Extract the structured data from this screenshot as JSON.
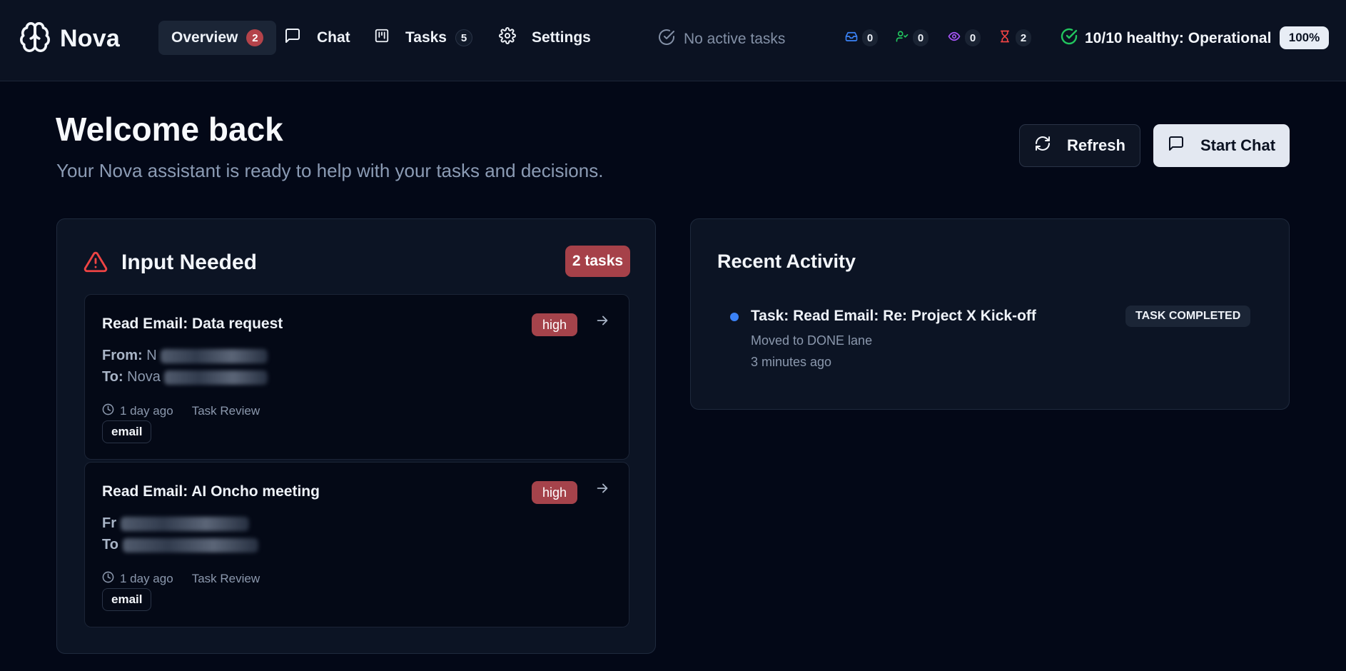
{
  "brand": {
    "name": "Nova",
    "icon": "brain-icon"
  },
  "nav": {
    "overview": {
      "label": "Overview",
      "count": "2"
    },
    "chat": {
      "label": "Chat",
      "icon": "chat-icon"
    },
    "tasks": {
      "label": "Tasks",
      "count": "5",
      "icon": "kanban-icon"
    },
    "settings": {
      "label": "Settings",
      "icon": "gear-icon"
    }
  },
  "status": {
    "active_tasks": "No active tasks",
    "stats": [
      {
        "icon": "inbox-icon",
        "color": "#3b82f6",
        "count": "0"
      },
      {
        "icon": "user-check-icon",
        "color": "#22c55e",
        "count": "0"
      },
      {
        "icon": "eye-icon",
        "color": "#a855f7",
        "count": "0"
      },
      {
        "icon": "hourglass-icon",
        "color": "#ef4444",
        "count": "2"
      }
    ],
    "health": "10/10 healthy: Operational",
    "percent": "100%"
  },
  "header": {
    "title": "Welcome back",
    "subtitle": "Your Nova assistant is ready to help with your tasks and decisions.",
    "refresh_label": "Refresh",
    "start_chat_label": "Start Chat"
  },
  "input_needed": {
    "title": "Input Needed",
    "badge": "2 tasks",
    "tasks": [
      {
        "title": "Read Email: Data request",
        "priority": "high",
        "from_label": "From:",
        "from_value": "N",
        "to_label": "To:",
        "to_value": "Nova",
        "time": "1 day ago",
        "stage": "Task Review",
        "tag": "email"
      },
      {
        "title": "Read Email: AI Oncho meeting",
        "priority": "high",
        "from_label": "Fr",
        "to_label": "To",
        "time": "1 day ago",
        "stage": "Task Review",
        "tag": "email"
      }
    ]
  },
  "recent_activity": {
    "title": "Recent Activity",
    "items": [
      {
        "title": "Task: Read Email: Re: Project X Kick-off",
        "subtitle": "Moved to DONE lane",
        "time": "3 minutes ago",
        "badge": "TASK COMPLETED"
      }
    ]
  },
  "colors": {
    "background": "#030817",
    "accent_red": "#a64149",
    "accent_blue": "#3b82f6",
    "health_green": "#22c55e"
  }
}
